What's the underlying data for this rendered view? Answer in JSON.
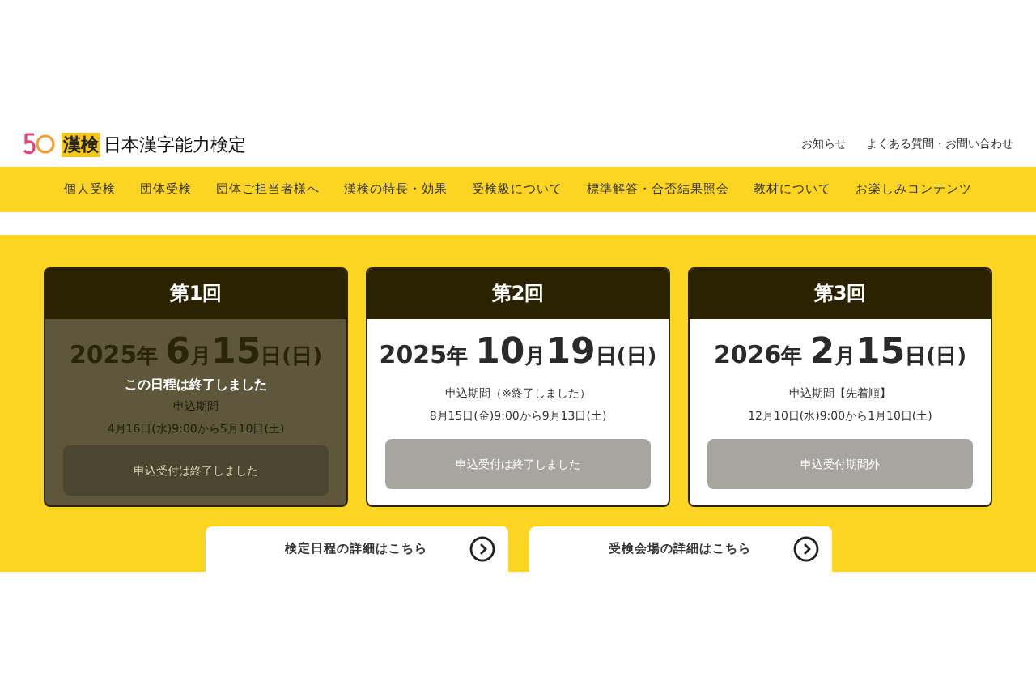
{
  "logo": {
    "badge": "漢検",
    "name": "日本漢字能力検定"
  },
  "header_links": [
    "お知らせ",
    "よくある質問・お問い合わせ"
  ],
  "nav": [
    "個人受検",
    "団体受検",
    "団体ご担当者様へ",
    "漢検の特長・効果",
    "受検級について",
    "標準解答・合否結果照会",
    "教材について",
    "お楽しみコンテンツ"
  ],
  "sessions": [
    {
      "title": "第1回",
      "date_parts": [
        {
          "text": "2025",
          "kind": "year"
        },
        {
          "text": "年 ",
          "kind": "unit"
        },
        {
          "text": "6",
          "kind": "big"
        },
        {
          "text": "月",
          "kind": "unit"
        },
        {
          "text": "15",
          "kind": "big"
        },
        {
          "text": "日(日)",
          "kind": "unit"
        }
      ],
      "period_label": "申込期間",
      "period": "4月16日(水)9:00から5月10日(土)",
      "button": "申込受付は終了しました",
      "ended": true,
      "ended_label": "この日程は終了しました"
    },
    {
      "title": "第2回",
      "date_parts": [
        {
          "text": "2025",
          "kind": "year"
        },
        {
          "text": "年 ",
          "kind": "unit"
        },
        {
          "text": "10",
          "kind": "big"
        },
        {
          "text": "月",
          "kind": "unit"
        },
        {
          "text": "19",
          "kind": "big"
        },
        {
          "text": "日(日)",
          "kind": "unit"
        }
      ],
      "period_label": "申込期間（※終了しました）",
      "period": "8月15日(金)9:00から9月13日(土)",
      "button": "申込受付は終了しました",
      "ended": false
    },
    {
      "title": "第3回",
      "date_parts": [
        {
          "text": "2026",
          "kind": "year"
        },
        {
          "text": "年 ",
          "kind": "unit"
        },
        {
          "text": "2",
          "kind": "big"
        },
        {
          "text": "月",
          "kind": "unit"
        },
        {
          "text": "15",
          "kind": "big"
        },
        {
          "text": "日(日)",
          "kind": "unit"
        }
      ],
      "period_label": "申込期間【先着順】",
      "period": "12月10日(水)9:00から1月10日(土)",
      "button": "申込受付期間外",
      "ended": false
    }
  ],
  "detail_links": [
    "検定日程の詳細はこちら",
    "受検会場の詳細はこちら"
  ]
}
